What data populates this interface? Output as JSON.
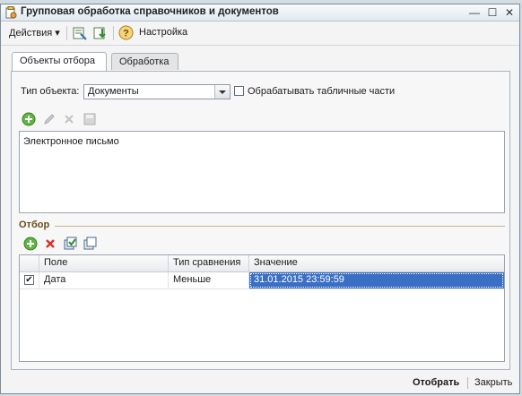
{
  "window": {
    "title": "Групповая обработка справочников и документов",
    "minimize_glyph": "—",
    "maximize_glyph": "☐",
    "close_glyph": "✕"
  },
  "toolbar": {
    "actions_label": "Действия",
    "actions_arrow": "▾",
    "settings_label": "Настройка",
    "help_glyph": "?"
  },
  "tabs": [
    {
      "label": "Объекты отбора",
      "active": true
    },
    {
      "label": "Обработка",
      "active": false
    }
  ],
  "selection": {
    "object_type_label": "Тип объекта:",
    "object_type_value": "Документы",
    "process_tables_label": "Обрабатывать табличные части",
    "process_tables_checked": false
  },
  "objects_list": {
    "items": [
      "Электронное письмо"
    ]
  },
  "filter": {
    "section_title": "Отбор",
    "columns": [
      "Поле",
      "Тип сравнения",
      "Значение"
    ],
    "rows": [
      {
        "enabled": true,
        "check_glyph": "✔",
        "field": "Дата",
        "comparison": "Меньше",
        "value": "31.01.2015 23:59:59"
      }
    ]
  },
  "footer": {
    "apply_label": "Отобрать",
    "close_label": "Закрыть"
  },
  "colors": {
    "accent": "#3a6fc4",
    "section_title": "#6b4b16",
    "window_bg": "#f4f4f4"
  },
  "icons": {
    "app": "app-icon",
    "add": "add-icon",
    "edit": "edit-icon",
    "delete": "delete-icon",
    "save": "save-icon",
    "check_all": "check-all-icon",
    "copy": "copy-icon",
    "help": "help-icon"
  }
}
